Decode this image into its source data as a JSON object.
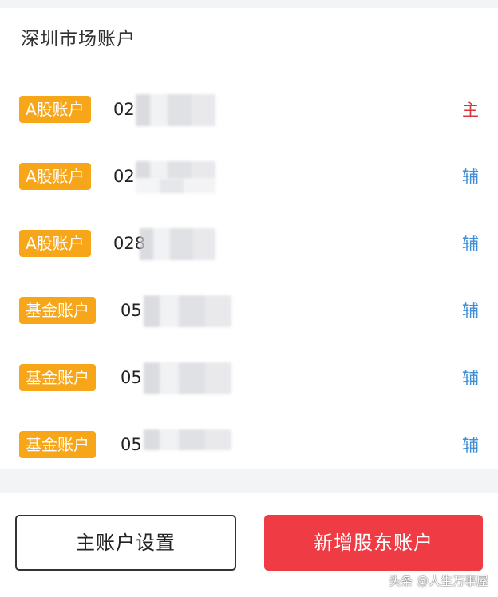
{
  "section_title": "深圳市场账户",
  "accounts": [
    {
      "type": "A股账户",
      "number": "02",
      "tag": "主"
    },
    {
      "type": "A股账户",
      "number": "02",
      "tag": "辅"
    },
    {
      "type": "A股账户",
      "number": "028",
      "tag": "辅"
    },
    {
      "type": "基金账户",
      "number": "05",
      "tag": "辅"
    },
    {
      "type": "基金账户",
      "number": "05",
      "tag": "辅"
    },
    {
      "type": "基金账户",
      "number": "05",
      "tag": "辅"
    }
  ],
  "footer": {
    "settings_button": "主账户设置",
    "add_button": "新增股东账户"
  },
  "watermark": "头条 @人生万事屋",
  "colors": {
    "badge": "#f7a61a",
    "main_tag": "#d9363e",
    "sub_tag": "#3e8ed8",
    "primary_button": "#ef3b44"
  }
}
